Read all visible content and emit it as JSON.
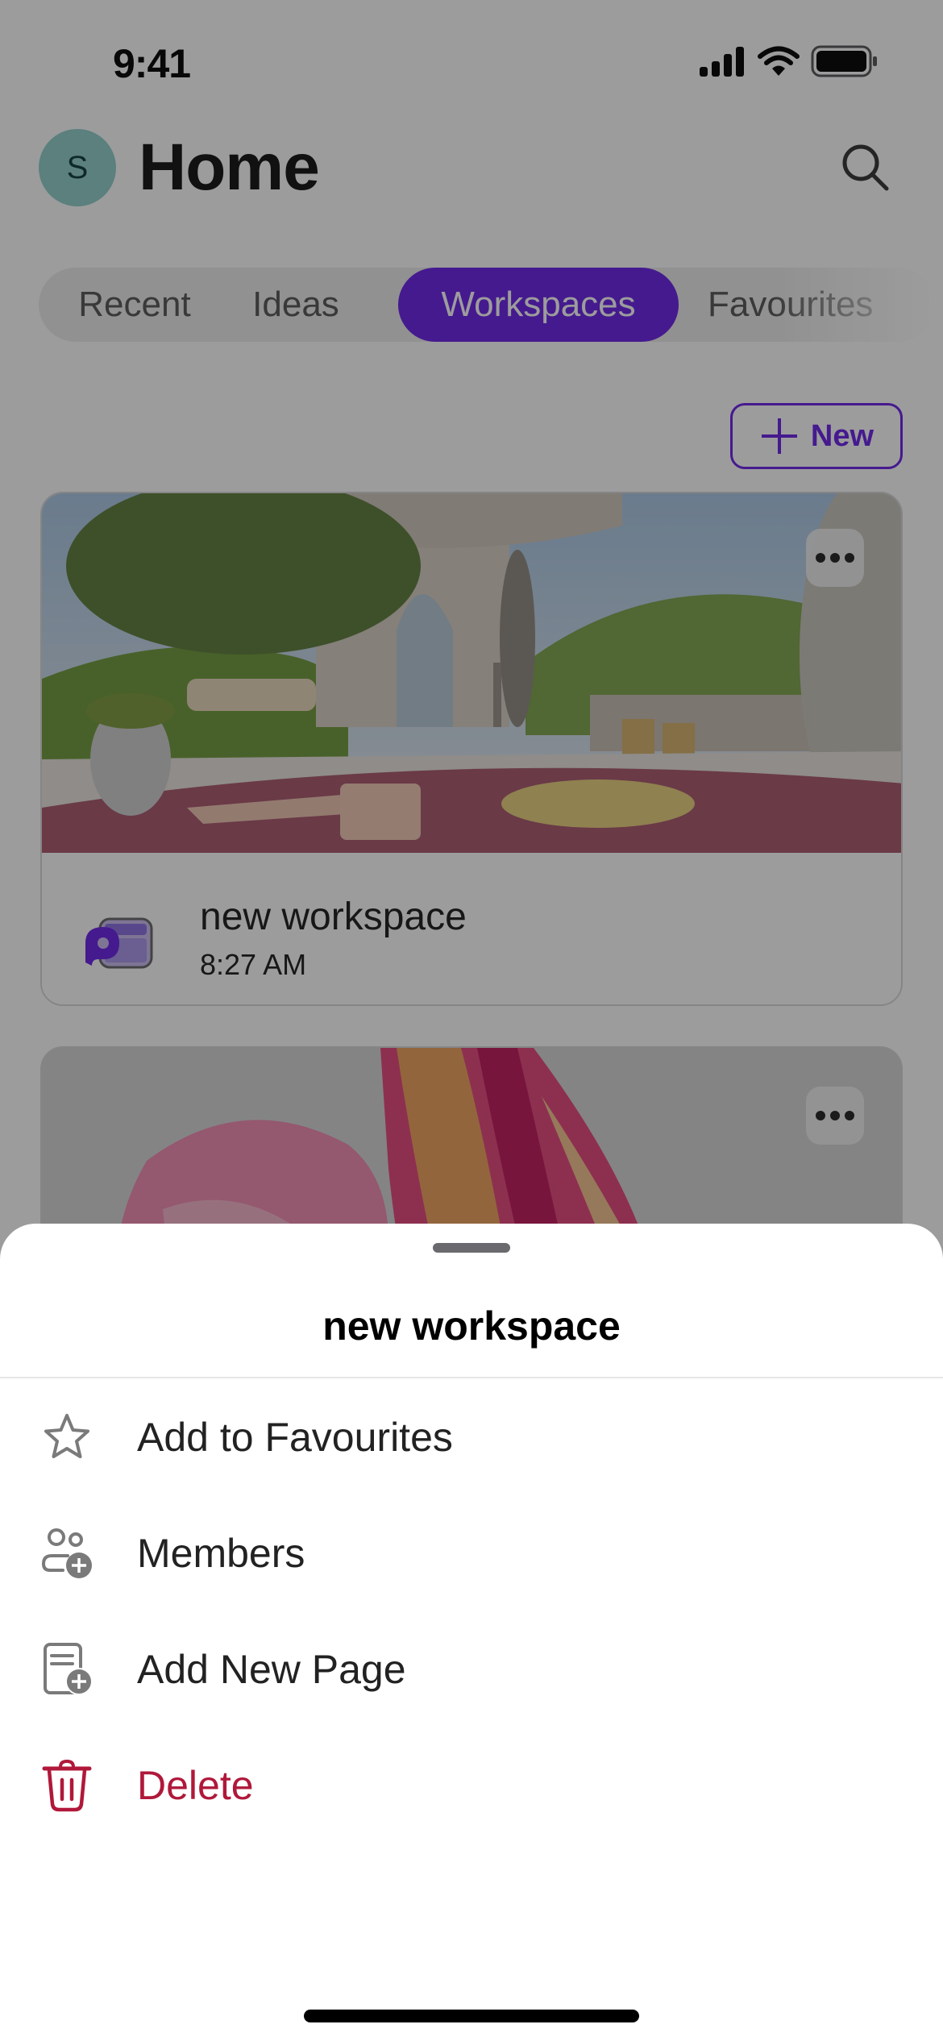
{
  "status_bar": {
    "time": "9:41",
    "icons": [
      "cellular-signal-icon",
      "wifi-icon",
      "battery-icon"
    ]
  },
  "header": {
    "avatar_initial": "S",
    "title": "Home",
    "search_icon": "search-icon"
  },
  "tabs": [
    {
      "label": "Recent",
      "active": false
    },
    {
      "label": "Ideas",
      "active": false
    },
    {
      "label": "Workspaces",
      "active": true
    },
    {
      "label": "Favourites",
      "active": false
    }
  ],
  "new_button": {
    "label": "New",
    "icon": "plus-icon"
  },
  "workspaces": [
    {
      "name": "new workspace",
      "time": "8:27 AM",
      "image": "courtyard-scene",
      "more_icon": "more-horizontal-icon"
    },
    {
      "image": "pink-swirl-abstract",
      "more_icon": "more-horizontal-icon"
    }
  ],
  "sheet": {
    "title": "new workspace",
    "items": [
      {
        "label": "Add to Favourites",
        "icon": "star-icon",
        "destructive": false
      },
      {
        "label": "Members",
        "icon": "members-add-icon",
        "destructive": false
      },
      {
        "label": "Add New Page",
        "icon": "page-add-icon",
        "destructive": false
      },
      {
        "label": "Delete",
        "icon": "trash-icon",
        "destructive": true
      }
    ]
  },
  "colors": {
    "accent": "#6a1fe6",
    "destructive": "#b0183a",
    "avatar": "#8fcfc9"
  }
}
